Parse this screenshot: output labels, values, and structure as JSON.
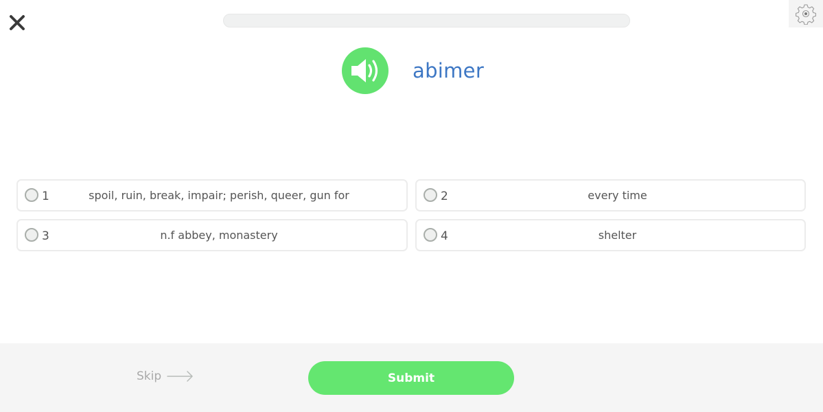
{
  "header": {
    "close_icon": "close-x-icon",
    "settings_icon": "gear-icon",
    "progress": {
      "percent": 0,
      "color": "#62e66f"
    }
  },
  "prompt": {
    "audio_icon": "speaker-icon",
    "word": "abimer"
  },
  "options": [
    {
      "number": "1",
      "text": "spoil, ruin, break, impair; perish, queer, gun for"
    },
    {
      "number": "2",
      "text": "every time"
    },
    {
      "number": "3",
      "text": "n.f abbey, monastery"
    },
    {
      "number": "4",
      "text": "shelter"
    }
  ],
  "footer": {
    "skip_label": "Skip",
    "skip_icon": "arrow-right-icon",
    "submit_label": "Submit"
  },
  "colors": {
    "accent_green": "#64e670",
    "word_blue": "#3d77c4"
  }
}
